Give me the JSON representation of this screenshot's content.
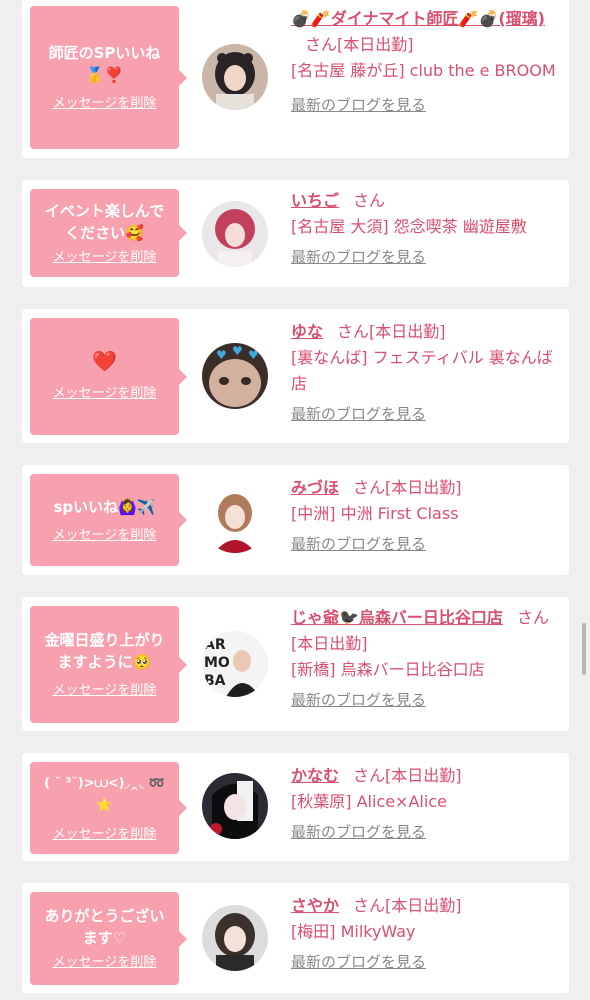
{
  "delete_label": "メッセージを削除",
  "blog_label": "最新のブログを見る",
  "theme": {
    "bubble_color": "#f7a0ae",
    "link_color": "#d94f6e",
    "card_bg": "#ffffff",
    "page_bg": "#efefef"
  },
  "cards": [
    {
      "message": "師匠のSPいいね\n🥇❣️",
      "name": "💣🧨ダイナマイト師匠🧨💣(瑠璃)",
      "san": "さん",
      "status": "[本日出勤]",
      "location": "[名古屋 藤が丘] club the e BROOM",
      "avatar": "avatar-woman-dark-hair"
    },
    {
      "message": "イベント楽しんで\nください🥰",
      "name": "いちご",
      "san": "さん",
      "status": "",
      "location": "[名古屋 大須] 怨念喫茶 幽遊屋敷",
      "avatar": "avatar-woman-pink-hair"
    },
    {
      "message": "❤️",
      "name": "ゆな",
      "san": "さん",
      "status": "[本日出勤]",
      "location": "[裏なんば] フェスティバル 裏なんば店",
      "avatar": "avatar-face-with-hearts"
    },
    {
      "message": "spいいね🙆‍♀️✈️",
      "name": "みづほ",
      "san": "さん",
      "status": "[本日出勤]",
      "location": "[中洲] 中洲 First Class",
      "avatar": "avatar-woman-red-dress"
    },
    {
      "message": "金曜日盛り上がり\nますように🥺",
      "name": "じゃ爺🐦‍⬛烏森バー日比谷口店",
      "san": "さん",
      "status": "[本日出勤]",
      "location": "[新橋] 烏森バー日比谷口店",
      "avatar": "avatar-man-suit"
    },
    {
      "message": "( ˘ ³˘)>⩊<)◞‸◟ ➿ ⭐",
      "name": "かなむ",
      "san": "さん",
      "status": "[本日出勤]",
      "location": "[秋葉原] Alice×Alice",
      "avatar": "avatar-woman-black-white-hair"
    },
    {
      "message": "ありがとうござい\nます♡",
      "name": "さやか",
      "san": "さん",
      "status": "[本日出勤]",
      "location": "[梅田] MilkyWay",
      "avatar": "avatar-woman-bob"
    }
  ]
}
